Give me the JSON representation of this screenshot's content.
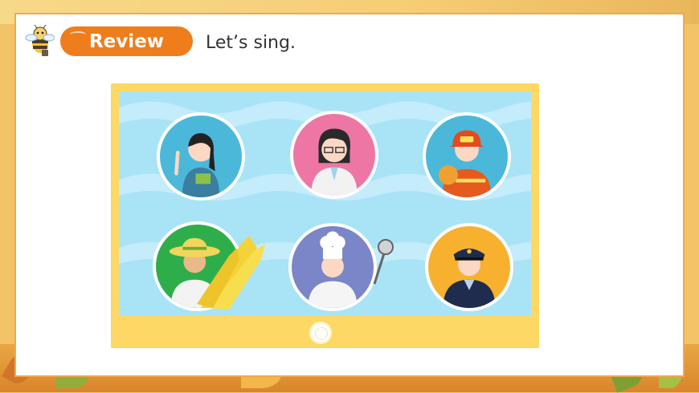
{
  "header": {
    "badge_label": "Review",
    "instruction": "Let’s sing."
  },
  "mascot": {
    "icon": "bee-icon"
  },
  "tablet": {
    "portraits": [
      {
        "icon": "teacher-icon",
        "bg": "#4bb8da"
      },
      {
        "icon": "doctor-icon",
        "bg": "#ee76a5"
      },
      {
        "icon": "firefighter-icon",
        "bg": "#4bb8da"
      },
      {
        "icon": "farmer-icon",
        "bg": "#2eae4a"
      },
      {
        "icon": "cook-icon",
        "bg": "#7a86c8"
      },
      {
        "icon": "police-officer-icon",
        "bg": "#f7b12e"
      }
    ],
    "home_button": {
      "icon": "home-button-icon"
    }
  },
  "colors": {
    "accent": "#ef7d1c",
    "card_border": "#f0a94a",
    "tablet_frame": "#fed864",
    "screen": "#a9e3f6"
  }
}
